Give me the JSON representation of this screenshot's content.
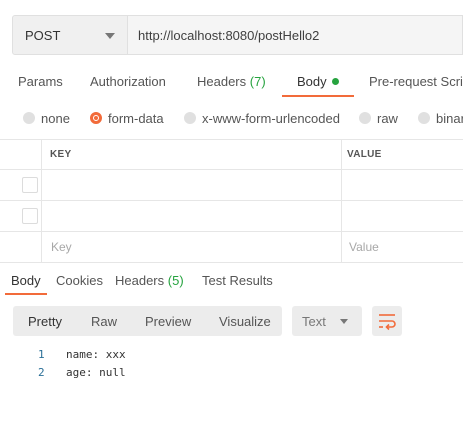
{
  "request": {
    "method": "POST",
    "url": "http://localhost:8080/postHello2"
  },
  "request_tabs": {
    "params": "Params",
    "authorization": "Authorization",
    "headers": "Headers",
    "headers_count": "(7)",
    "body": "Body",
    "pre_request": "Pre-request Script"
  },
  "body_types": {
    "none": "none",
    "form_data": "form-data",
    "urlencoded": "x-www-form-urlencoded",
    "raw": "raw",
    "binary": "binary",
    "selected": "form-data"
  },
  "params_table": {
    "key_header": "KEY",
    "value_header": "VALUE",
    "key_placeholder": "Key",
    "value_placeholder": "Value"
  },
  "response_tabs": {
    "body": "Body",
    "cookies": "Cookies",
    "headers": "Headers",
    "headers_count": "(5)",
    "test_results": "Test Results"
  },
  "view_modes": {
    "pretty": "Pretty",
    "raw": "Raw",
    "preview": "Preview",
    "visualize": "Visualize",
    "format": "Text"
  },
  "response_lines": [
    {
      "num": "1",
      "text": "name: xxx"
    },
    {
      "num": "2",
      "text": "age: null"
    }
  ],
  "colors": {
    "accent": "#f26b3a",
    "count_green": "#26a33f"
  }
}
